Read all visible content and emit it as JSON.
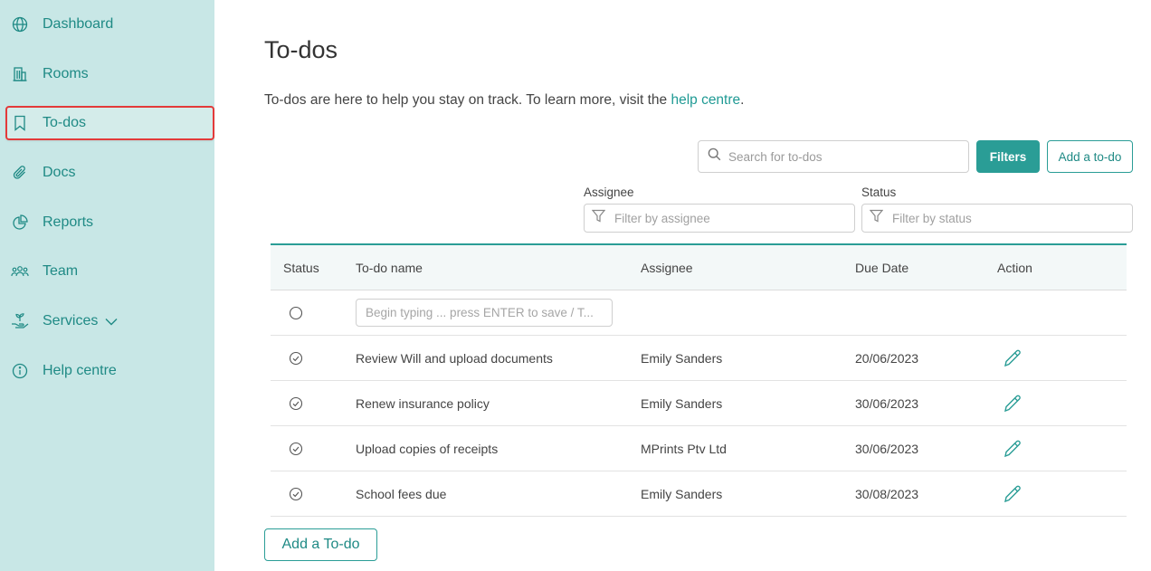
{
  "sidebar": {
    "items": [
      {
        "label": "Dashboard",
        "icon": "globe-icon"
      },
      {
        "label": "Rooms",
        "icon": "building-icon"
      },
      {
        "label": "To-dos",
        "icon": "bookmark-icon",
        "active": true
      },
      {
        "label": "Docs",
        "icon": "paperclip-icon"
      },
      {
        "label": "Reports",
        "icon": "pie-chart-icon"
      },
      {
        "label": "Team",
        "icon": "team-icon"
      },
      {
        "label": "Services",
        "icon": "hand-plant-icon",
        "has_dropdown": true
      },
      {
        "label": "Help centre",
        "icon": "info-icon"
      }
    ]
  },
  "page": {
    "title": "To-dos",
    "intro_text": "To-dos are here to help you stay on track. To learn more, visit the ",
    "intro_link": "help centre",
    "intro_end": "."
  },
  "toolbar": {
    "search_placeholder": "Search for to-dos",
    "filters_label": "Filters",
    "add_label": "Add a to-do"
  },
  "filters": {
    "assignee_label": "Assignee",
    "assignee_placeholder": "Filter by assignee",
    "status_label": "Status",
    "status_placeholder": "Filter by status"
  },
  "table": {
    "headers": {
      "status": "Status",
      "name": "To-do name",
      "assignee": "Assignee",
      "due": "Due Date",
      "action": "Action"
    },
    "new_placeholder": "Begin typing ... press ENTER to save / T...",
    "rows": [
      {
        "name": "Review Will and upload documents",
        "assignee": "Emily Sanders",
        "due": "20/06/2023"
      },
      {
        "name": "Renew insurance policy",
        "assignee": "Emily Sanders",
        "due": "30/06/2023"
      },
      {
        "name": "Upload copies of receipts",
        "assignee": "MPrints Ptv Ltd",
        "due": "30/06/2023"
      },
      {
        "name": "School fees due",
        "assignee": "Emily Sanders",
        "due": "30/08/2023"
      }
    ]
  },
  "footer": {
    "add_label": "Add a To-do"
  },
  "colors": {
    "accent": "#2a9d96",
    "sidebar_bg": "#c8e7e6",
    "active_border": "#e33a3a"
  }
}
